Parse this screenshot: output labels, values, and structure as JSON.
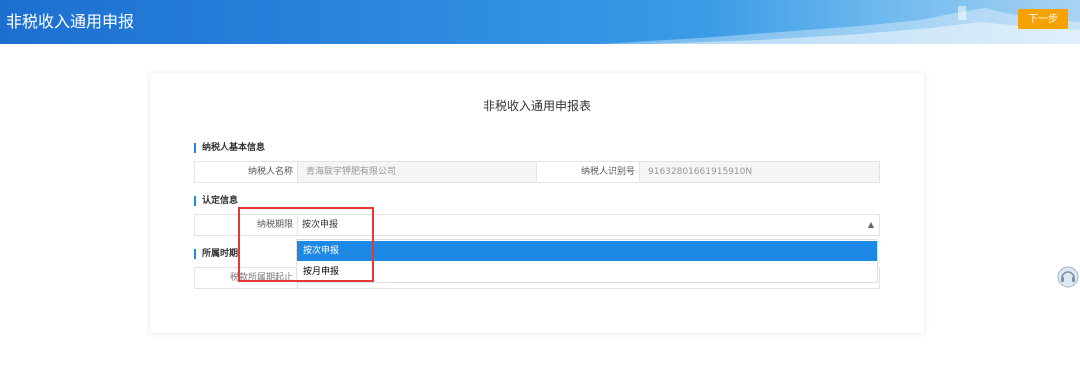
{
  "header": {
    "title": "非税收入通用申报",
    "next_label": "下一步"
  },
  "form": {
    "title": "非税收入通用申报表",
    "basic_section": "纳税人基本信息",
    "taxpayer_name_label": "纳税人名称",
    "taxpayer_name_value": "青海联宇钾肥有限公司",
    "taxpayer_id_label": "纳税人识别号",
    "taxpayer_id_value": "91632801661915910N",
    "auth_section": "认定信息",
    "period_label": "纳税期限",
    "period_value": "按次申报",
    "period_options": [
      "按次申报",
      "按月申报"
    ],
    "belong_section": "所属时期",
    "belong_start_label": "税款所属期起止"
  },
  "colors": {
    "accent": "#1e88e5",
    "button": "#f5a200",
    "highlight": "#e53935"
  }
}
